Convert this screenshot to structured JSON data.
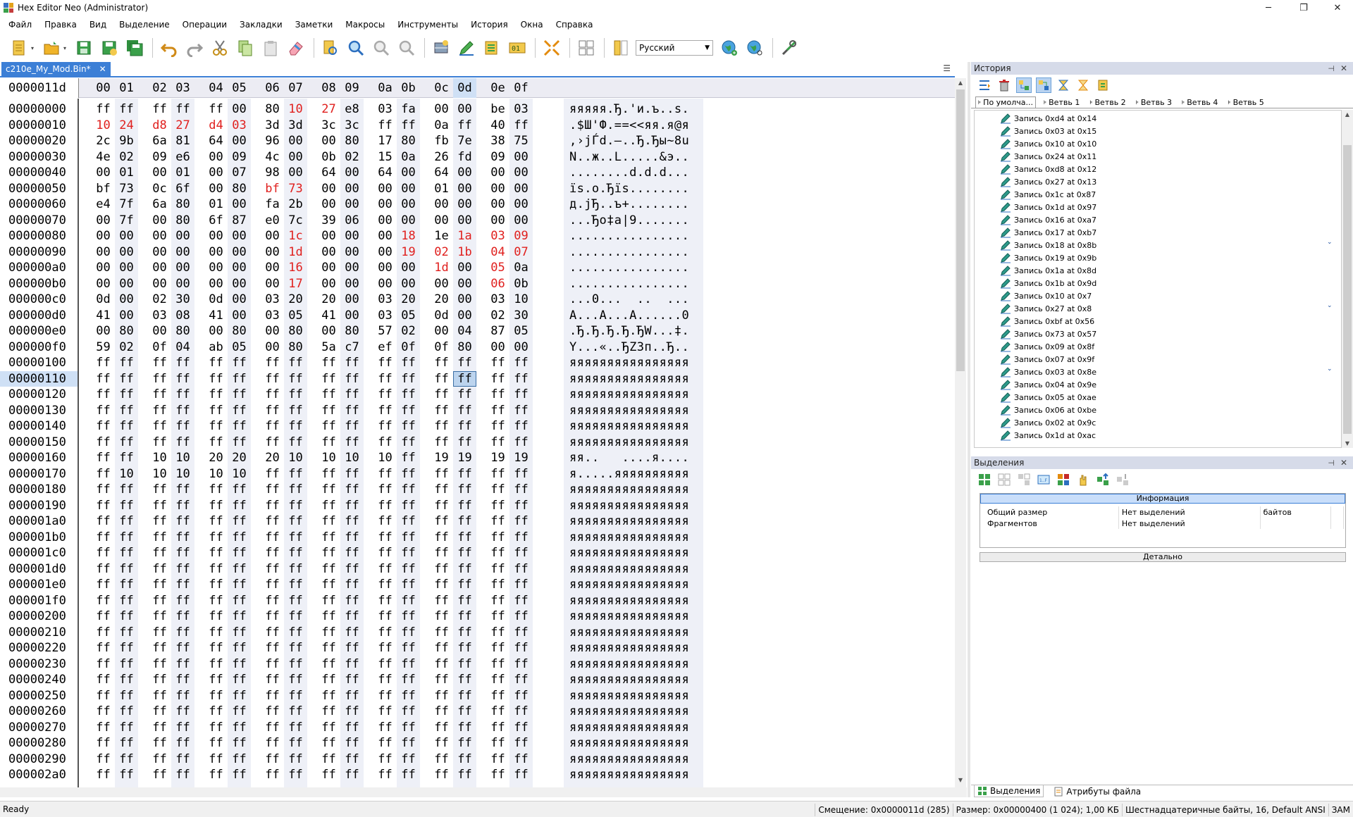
{
  "window": {
    "title": "Hex Editor Neo (Administrator)",
    "minimize": "─",
    "maximize": "❐",
    "close": "✕"
  },
  "menu": [
    "Файл",
    "Правка",
    "Вид",
    "Выделение",
    "Операции",
    "Закладки",
    "Заметки",
    "Макросы",
    "Инструменты",
    "История",
    "Окна",
    "Справка"
  ],
  "toolbar": {
    "language": "Русский"
  },
  "document": {
    "tab": "c210e_My_Mod.Bin*",
    "close": "✕",
    "current_offset": "0000011d"
  },
  "hex": {
    "columns": [
      "00",
      "01",
      "02",
      "03",
      "04",
      "05",
      "06",
      "07",
      "08",
      "09",
      "0a",
      "0b",
      "0c",
      "0d",
      "0e",
      "0f"
    ],
    "selected_column": 13,
    "cursor": {
      "row": 17,
      "col": 13
    },
    "rows": [
      {
        "addr": "00000000",
        "bytes": [
          "ff",
          "ff",
          "ff",
          "ff",
          "ff",
          "00",
          "80",
          "10",
          "27",
          "e8",
          "03",
          "fa",
          "00",
          "00",
          "be",
          "03"
        ],
        "mod": [
          7,
          8
        ],
        "ascii": "яяяяя.Ђ.'и.ъ..s."
      },
      {
        "addr": "00000010",
        "bytes": [
          "10",
          "24",
          "d8",
          "27",
          "d4",
          "03",
          "3d",
          "3d",
          "3c",
          "3c",
          "ff",
          "ff",
          "0a",
          "ff",
          "40",
          "ff"
        ],
        "mod": [
          0,
          1,
          2,
          3,
          4,
          5
        ],
        "ascii": ".$Ш'Ф.==<<яя.я@я"
      },
      {
        "addr": "00000020",
        "bytes": [
          "2c",
          "9b",
          "6a",
          "81",
          "64",
          "00",
          "96",
          "00",
          "00",
          "80",
          "17",
          "80",
          "fb",
          "7e",
          "38",
          "75"
        ],
        "mod": [],
        "ascii": ",›jЃd.–..Ђ.Ђы~8u"
      },
      {
        "addr": "00000030",
        "bytes": [
          "4e",
          "02",
          "09",
          "e6",
          "00",
          "09",
          "4c",
          "00",
          "0b",
          "02",
          "15",
          "0a",
          "26",
          "fd",
          "09",
          "00"
        ],
        "mod": [],
        "ascii": "N..ж..L.....&э.."
      },
      {
        "addr": "00000040",
        "bytes": [
          "00",
          "01",
          "00",
          "01",
          "00",
          "07",
          "98",
          "00",
          "64",
          "00",
          "64",
          "00",
          "64",
          "00",
          "00",
          "00"
        ],
        "mod": [],
        "ascii": "........d.d.d..."
      },
      {
        "addr": "00000050",
        "bytes": [
          "bf",
          "73",
          "0c",
          "6f",
          "00",
          "80",
          "bf",
          "73",
          "00",
          "00",
          "00",
          "00",
          "01",
          "00",
          "00",
          "00"
        ],
        "mod": [
          6,
          7
        ],
        "ascii": "їs.o.Ђїs........"
      },
      {
        "addr": "00000060",
        "bytes": [
          "e4",
          "7f",
          "6a",
          "80",
          "01",
          "00",
          "fa",
          "2b",
          "00",
          "00",
          "00",
          "00",
          "00",
          "00",
          "00",
          "00"
        ],
        "mod": [],
        "ascii": "д.jЂ..ъ+........"
      },
      {
        "addr": "00000070",
        "bytes": [
          "00",
          "7f",
          "00",
          "80",
          "6f",
          "87",
          "e0",
          "7c",
          "39",
          "06",
          "00",
          "00",
          "00",
          "00",
          "00",
          "00"
        ],
        "mod": [],
        "ascii": "...Ђo‡а|9......."
      },
      {
        "addr": "00000080",
        "bytes": [
          "00",
          "00",
          "00",
          "00",
          "00",
          "00",
          "00",
          "1c",
          "00",
          "00",
          "00",
          "18",
          "1e",
          "1a",
          "03",
          "09"
        ],
        "mod": [
          7,
          11,
          13,
          14,
          15
        ],
        "ascii": "................"
      },
      {
        "addr": "00000090",
        "bytes": [
          "00",
          "00",
          "00",
          "00",
          "00",
          "00",
          "00",
          "1d",
          "00",
          "00",
          "00",
          "19",
          "02",
          "1b",
          "04",
          "07"
        ],
        "mod": [
          7,
          11,
          12,
          13,
          14,
          15
        ],
        "ascii": "................"
      },
      {
        "addr": "000000a0",
        "bytes": [
          "00",
          "00",
          "00",
          "00",
          "00",
          "00",
          "00",
          "16",
          "00",
          "00",
          "00",
          "00",
          "1d",
          "00",
          "05",
          "0a"
        ],
        "mod": [
          7,
          12,
          14
        ],
        "ascii": "................"
      },
      {
        "addr": "000000b0",
        "bytes": [
          "00",
          "00",
          "00",
          "00",
          "00",
          "00",
          "00",
          "17",
          "00",
          "00",
          "00",
          "00",
          "00",
          "00",
          "06",
          "0b"
        ],
        "mod": [
          7,
          14
        ],
        "ascii": "................"
      },
      {
        "addr": "000000c0",
        "bytes": [
          "0d",
          "00",
          "02",
          "30",
          "0d",
          "00",
          "03",
          "20",
          "20",
          "00",
          "03",
          "20",
          "20",
          "00",
          "03",
          "10"
        ],
        "mod": [],
        "ascii": "...0...  ..  ..."
      },
      {
        "addr": "000000d0",
        "bytes": [
          "41",
          "00",
          "03",
          "08",
          "41",
          "00",
          "03",
          "05",
          "41",
          "00",
          "03",
          "05",
          "0d",
          "00",
          "02",
          "30"
        ],
        "mod": [],
        "ascii": "A...A...A......0"
      },
      {
        "addr": "000000e0",
        "bytes": [
          "00",
          "80",
          "00",
          "80",
          "00",
          "80",
          "00",
          "80",
          "00",
          "80",
          "57",
          "02",
          "00",
          "04",
          "87",
          "05"
        ],
        "mod": [],
        "ascii": ".Ђ.Ђ.Ђ.Ђ.ЂW...‡."
      },
      {
        "addr": "000000f0",
        "bytes": [
          "59",
          "02",
          "0f",
          "04",
          "ab",
          "05",
          "00",
          "80",
          "5a",
          "c7",
          "ef",
          "0f",
          "0f",
          "80",
          "00",
          "00"
        ],
        "mod": [],
        "ascii": "Y...«..ЂZЗп..Ђ.."
      },
      {
        "addr": "00000100",
        "bytes": [
          "ff",
          "ff",
          "ff",
          "ff",
          "ff",
          "ff",
          "ff",
          "ff",
          "ff",
          "ff",
          "ff",
          "ff",
          "ff",
          "ff",
          "ff",
          "ff"
        ],
        "mod": [],
        "ascii": "яяяяяяяяяяяяяяяя"
      },
      {
        "addr": "00000110",
        "bytes": [
          "ff",
          "ff",
          "ff",
          "ff",
          "ff",
          "ff",
          "ff",
          "ff",
          "ff",
          "ff",
          "ff",
          "ff",
          "ff",
          "ff",
          "ff",
          "ff"
        ],
        "mod": [],
        "ascii": "яяяяяяяяяяяяяяяя"
      },
      {
        "addr": "00000120",
        "bytes": [
          "ff",
          "ff",
          "ff",
          "ff",
          "ff",
          "ff",
          "ff",
          "ff",
          "ff",
          "ff",
          "ff",
          "ff",
          "ff",
          "ff",
          "ff",
          "ff"
        ],
        "mod": [],
        "ascii": "яяяяяяяяяяяяяяяя"
      },
      {
        "addr": "00000130",
        "bytes": [
          "ff",
          "ff",
          "ff",
          "ff",
          "ff",
          "ff",
          "ff",
          "ff",
          "ff",
          "ff",
          "ff",
          "ff",
          "ff",
          "ff",
          "ff",
          "ff"
        ],
        "mod": [],
        "ascii": "яяяяяяяяяяяяяяяя"
      },
      {
        "addr": "00000140",
        "bytes": [
          "ff",
          "ff",
          "ff",
          "ff",
          "ff",
          "ff",
          "ff",
          "ff",
          "ff",
          "ff",
          "ff",
          "ff",
          "ff",
          "ff",
          "ff",
          "ff"
        ],
        "mod": [],
        "ascii": "яяяяяяяяяяяяяяяя"
      },
      {
        "addr": "00000150",
        "bytes": [
          "ff",
          "ff",
          "ff",
          "ff",
          "ff",
          "ff",
          "ff",
          "ff",
          "ff",
          "ff",
          "ff",
          "ff",
          "ff",
          "ff",
          "ff",
          "ff"
        ],
        "mod": [],
        "ascii": "яяяяяяяяяяяяяяяя"
      },
      {
        "addr": "00000160",
        "bytes": [
          "ff",
          "ff",
          "10",
          "10",
          "20",
          "20",
          "20",
          "10",
          "10",
          "10",
          "10",
          "ff",
          "19",
          "19",
          "19",
          "19"
        ],
        "mod": [],
        "ascii": "яя..   ....я...."
      },
      {
        "addr": "00000170",
        "bytes": [
          "ff",
          "10",
          "10",
          "10",
          "10",
          "10",
          "ff",
          "ff",
          "ff",
          "ff",
          "ff",
          "ff",
          "ff",
          "ff",
          "ff",
          "ff"
        ],
        "mod": [],
        "ascii": "я.....яяяяяяяяяя"
      },
      {
        "addr": "00000180",
        "bytes": [
          "ff",
          "ff",
          "ff",
          "ff",
          "ff",
          "ff",
          "ff",
          "ff",
          "ff",
          "ff",
          "ff",
          "ff",
          "ff",
          "ff",
          "ff",
          "ff"
        ],
        "mod": [],
        "ascii": "яяяяяяяяяяяяяяяя"
      },
      {
        "addr": "00000190",
        "bytes": [
          "ff",
          "ff",
          "ff",
          "ff",
          "ff",
          "ff",
          "ff",
          "ff",
          "ff",
          "ff",
          "ff",
          "ff",
          "ff",
          "ff",
          "ff",
          "ff"
        ],
        "mod": [],
        "ascii": "яяяяяяяяяяяяяяяя"
      },
      {
        "addr": "000001a0",
        "bytes": [
          "ff",
          "ff",
          "ff",
          "ff",
          "ff",
          "ff",
          "ff",
          "ff",
          "ff",
          "ff",
          "ff",
          "ff",
          "ff",
          "ff",
          "ff",
          "ff"
        ],
        "mod": [],
        "ascii": "яяяяяяяяяяяяяяяя"
      },
      {
        "addr": "000001b0",
        "bytes": [
          "ff",
          "ff",
          "ff",
          "ff",
          "ff",
          "ff",
          "ff",
          "ff",
          "ff",
          "ff",
          "ff",
          "ff",
          "ff",
          "ff",
          "ff",
          "ff"
        ],
        "mod": [],
        "ascii": "яяяяяяяяяяяяяяяя"
      },
      {
        "addr": "000001c0",
        "bytes": [
          "ff",
          "ff",
          "ff",
          "ff",
          "ff",
          "ff",
          "ff",
          "ff",
          "ff",
          "ff",
          "ff",
          "ff",
          "ff",
          "ff",
          "ff",
          "ff"
        ],
        "mod": [],
        "ascii": "яяяяяяяяяяяяяяяя"
      },
      {
        "addr": "000001d0",
        "bytes": [
          "ff",
          "ff",
          "ff",
          "ff",
          "ff",
          "ff",
          "ff",
          "ff",
          "ff",
          "ff",
          "ff",
          "ff",
          "ff",
          "ff",
          "ff",
          "ff"
        ],
        "mod": [],
        "ascii": "яяяяяяяяяяяяяяяя"
      },
      {
        "addr": "000001e0",
        "bytes": [
          "ff",
          "ff",
          "ff",
          "ff",
          "ff",
          "ff",
          "ff",
          "ff",
          "ff",
          "ff",
          "ff",
          "ff",
          "ff",
          "ff",
          "ff",
          "ff"
        ],
        "mod": [],
        "ascii": "яяяяяяяяяяяяяяяя"
      },
      {
        "addr": "000001f0",
        "bytes": [
          "ff",
          "ff",
          "ff",
          "ff",
          "ff",
          "ff",
          "ff",
          "ff",
          "ff",
          "ff",
          "ff",
          "ff",
          "ff",
          "ff",
          "ff",
          "ff"
        ],
        "mod": [],
        "ascii": "яяяяяяяяяяяяяяяя"
      },
      {
        "addr": "00000200",
        "bytes": [
          "ff",
          "ff",
          "ff",
          "ff",
          "ff",
          "ff",
          "ff",
          "ff",
          "ff",
          "ff",
          "ff",
          "ff",
          "ff",
          "ff",
          "ff",
          "ff"
        ],
        "mod": [],
        "ascii": "яяяяяяяяяяяяяяяя"
      },
      {
        "addr": "00000210",
        "bytes": [
          "ff",
          "ff",
          "ff",
          "ff",
          "ff",
          "ff",
          "ff",
          "ff",
          "ff",
          "ff",
          "ff",
          "ff",
          "ff",
          "ff",
          "ff",
          "ff"
        ],
        "mod": [],
        "ascii": "яяяяяяяяяяяяяяяя"
      },
      {
        "addr": "00000220",
        "bytes": [
          "ff",
          "ff",
          "ff",
          "ff",
          "ff",
          "ff",
          "ff",
          "ff",
          "ff",
          "ff",
          "ff",
          "ff",
          "ff",
          "ff",
          "ff",
          "ff"
        ],
        "mod": [],
        "ascii": "яяяяяяяяяяяяяяяя"
      },
      {
        "addr": "00000230",
        "bytes": [
          "ff",
          "ff",
          "ff",
          "ff",
          "ff",
          "ff",
          "ff",
          "ff",
          "ff",
          "ff",
          "ff",
          "ff",
          "ff",
          "ff",
          "ff",
          "ff"
        ],
        "mod": [],
        "ascii": "яяяяяяяяяяяяяяяя"
      },
      {
        "addr": "00000240",
        "bytes": [
          "ff",
          "ff",
          "ff",
          "ff",
          "ff",
          "ff",
          "ff",
          "ff",
          "ff",
          "ff",
          "ff",
          "ff",
          "ff",
          "ff",
          "ff",
          "ff"
        ],
        "mod": [],
        "ascii": "яяяяяяяяяяяяяяяя"
      },
      {
        "addr": "00000250",
        "bytes": [
          "ff",
          "ff",
          "ff",
          "ff",
          "ff",
          "ff",
          "ff",
          "ff",
          "ff",
          "ff",
          "ff",
          "ff",
          "ff",
          "ff",
          "ff",
          "ff"
        ],
        "mod": [],
        "ascii": "яяяяяяяяяяяяяяяя"
      },
      {
        "addr": "00000260",
        "bytes": [
          "ff",
          "ff",
          "ff",
          "ff",
          "ff",
          "ff",
          "ff",
          "ff",
          "ff",
          "ff",
          "ff",
          "ff",
          "ff",
          "ff",
          "ff",
          "ff"
        ],
        "mod": [],
        "ascii": "яяяяяяяяяяяяяяяя"
      },
      {
        "addr": "00000270",
        "bytes": [
          "ff",
          "ff",
          "ff",
          "ff",
          "ff",
          "ff",
          "ff",
          "ff",
          "ff",
          "ff",
          "ff",
          "ff",
          "ff",
          "ff",
          "ff",
          "ff"
        ],
        "mod": [],
        "ascii": "яяяяяяяяяяяяяяяя"
      },
      {
        "addr": "00000280",
        "bytes": [
          "ff",
          "ff",
          "ff",
          "ff",
          "ff",
          "ff",
          "ff",
          "ff",
          "ff",
          "ff",
          "ff",
          "ff",
          "ff",
          "ff",
          "ff",
          "ff"
        ],
        "mod": [],
        "ascii": "яяяяяяяяяяяяяяяя"
      },
      {
        "addr": "00000290",
        "bytes": [
          "ff",
          "ff",
          "ff",
          "ff",
          "ff",
          "ff",
          "ff",
          "ff",
          "ff",
          "ff",
          "ff",
          "ff",
          "ff",
          "ff",
          "ff",
          "ff"
        ],
        "mod": [],
        "ascii": "яяяяяяяяяяяяяяяя"
      },
      {
        "addr": "000002a0",
        "bytes": [
          "ff",
          "ff",
          "ff",
          "ff",
          "ff",
          "ff",
          "ff",
          "ff",
          "ff",
          "ff",
          "ff",
          "ff",
          "ff",
          "ff",
          "ff",
          "ff"
        ],
        "mod": [],
        "ascii": "яяяяяяяяяяяяяяяя"
      }
    ]
  },
  "history": {
    "title": "История",
    "tabs": [
      "По умолча...",
      "Ветвь 1",
      "Ветвь 2",
      "Ветвь 3",
      "Ветвь 4",
      "Ветвь 5"
    ],
    "items": [
      "Запись 0xd4 at 0x14",
      "Запись 0x03 at 0x15",
      "Запись 0x10 at 0x10",
      "Запись 0x24 at 0x11",
      "Запись 0xd8 at 0x12",
      "Запись 0x27 at 0x13",
      "Запись 0x1c at 0x87",
      "Запись 0x1d at 0x97",
      "Запись 0x16 at 0xa7",
      "Запись 0x17 at 0xb7",
      "Запись 0x18 at 0x8b",
      "Запись 0x19 at 0x9b",
      "Запись 0x1a at 0x8d",
      "Запись 0x1b at 0x9d",
      "Запись 0x10 at 0x7",
      "Запись 0x27 at 0x8",
      "Запись 0xbf at 0x56",
      "Запись 0x73 at 0x57",
      "Запись 0x09 at 0x8f",
      "Запись 0x07 at 0x9f",
      "Запись 0x03 at 0x8e",
      "Запись 0x04 at 0x9e",
      "Запись 0x05 at 0xae",
      "Запись 0x06 at 0xbe",
      "Запись 0x02 at 0x9c",
      "Запись 0x1d at 0xac"
    ],
    "chevron_rows": [
      10,
      15,
      20
    ]
  },
  "selection": {
    "title": "Выделения",
    "info_title": "Информация",
    "rows": [
      [
        "Общий размер",
        "Нет выделений",
        "байтов"
      ],
      [
        "Фрагментов",
        "Нет выделений",
        ""
      ]
    ],
    "detail": "Детально"
  },
  "bottom_tabs": [
    "Выделения",
    "Атрибуты файла"
  ],
  "status": {
    "ready": "Ready",
    "offset": "Смещение: 0x0000011d (285)",
    "size": "Размер: 0x00000400 (1 024); 1,00 КБ",
    "mode": "Шестнадцатеричные байты, 16, Default ANSI",
    "ins": "ЗАМ"
  },
  "colors": {
    "accent": "#3c7fd6",
    "modified": "#e0201e",
    "selected": "#cfe0f5"
  }
}
